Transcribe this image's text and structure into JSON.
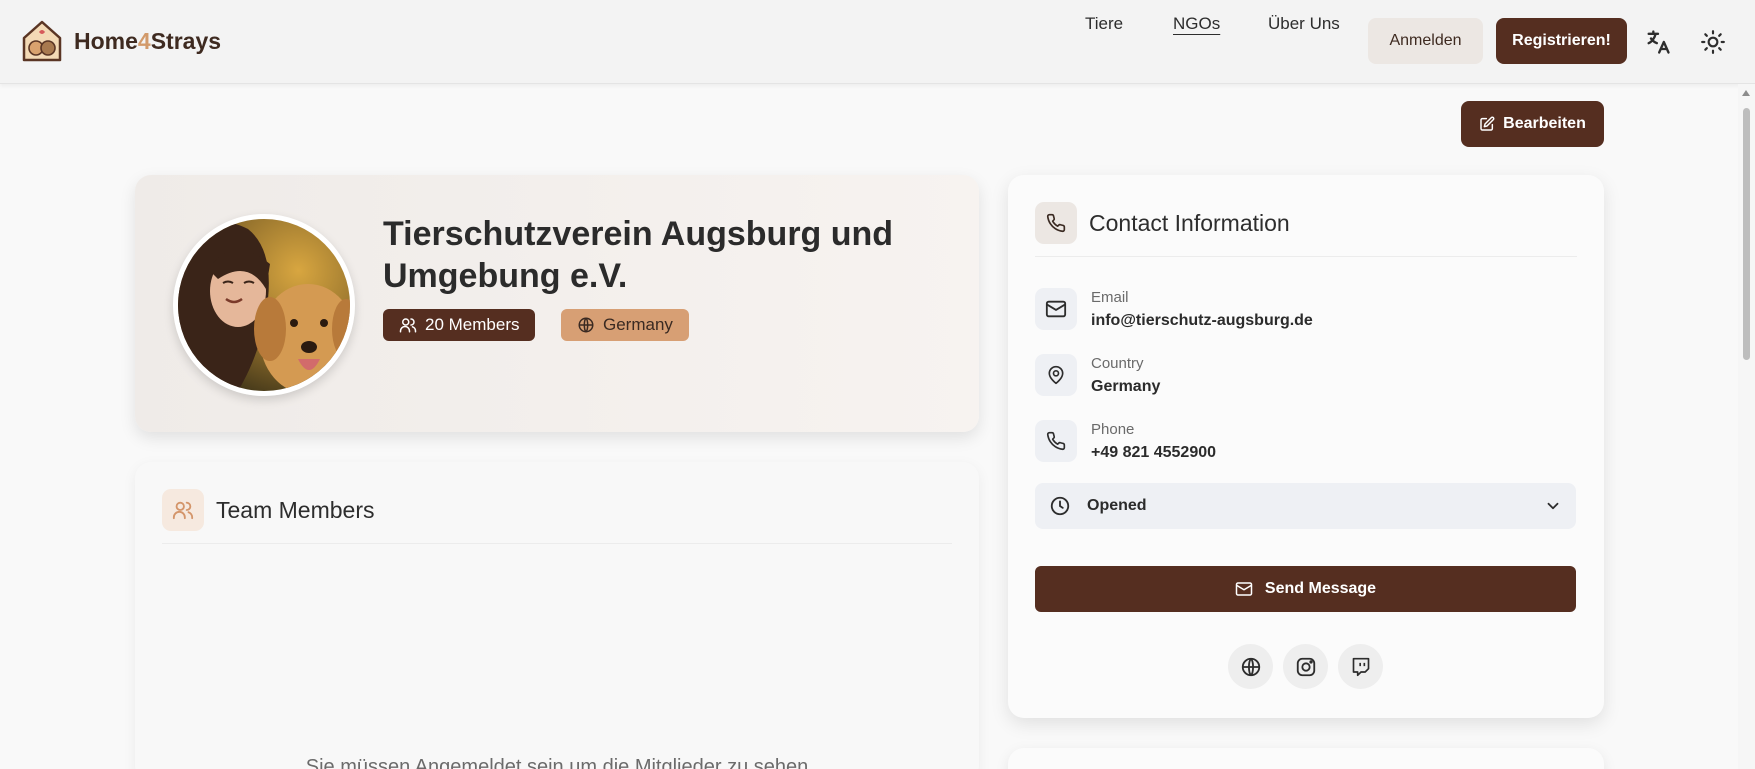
{
  "header": {
    "brand_prefix": "Home",
    "brand_accent": "4",
    "brand_suffix": "Strays",
    "nav": {
      "animals": "Tiere",
      "ngos": "NGOs",
      "about": "Über Uns"
    },
    "login_label": "Anmelden",
    "register_label": "Registrieren!",
    "icons": [
      "translate-icon",
      "sun-icon"
    ]
  },
  "edit_button_label": "Bearbeiten",
  "profile": {
    "name": "Tierschutzverein Augsburg und Umgebung e.V.",
    "members_badge": "20 Members",
    "country_badge": "Germany"
  },
  "team": {
    "title": "Team Members",
    "login_note": "Sie müssen Angemeldet sein um die Mitglieder zu sehen"
  },
  "contact": {
    "title": "Contact Information",
    "email_label": "Email",
    "email_value": "info@tierschutz-augsburg.de",
    "country_label": "Country",
    "country_value": "Germany",
    "phone_label": "Phone",
    "phone_value": "+49 821 4552900",
    "hours_label": "Opened",
    "send_label": "Send Message",
    "social_icons": [
      "globe-icon",
      "instagram-icon",
      "twitch-icon"
    ]
  },
  "colors": {
    "brand_dark": "#552e20",
    "brand_accent": "#d29a6a",
    "badge_country": "#d79f74",
    "page_bg": "#f9f9f9"
  }
}
